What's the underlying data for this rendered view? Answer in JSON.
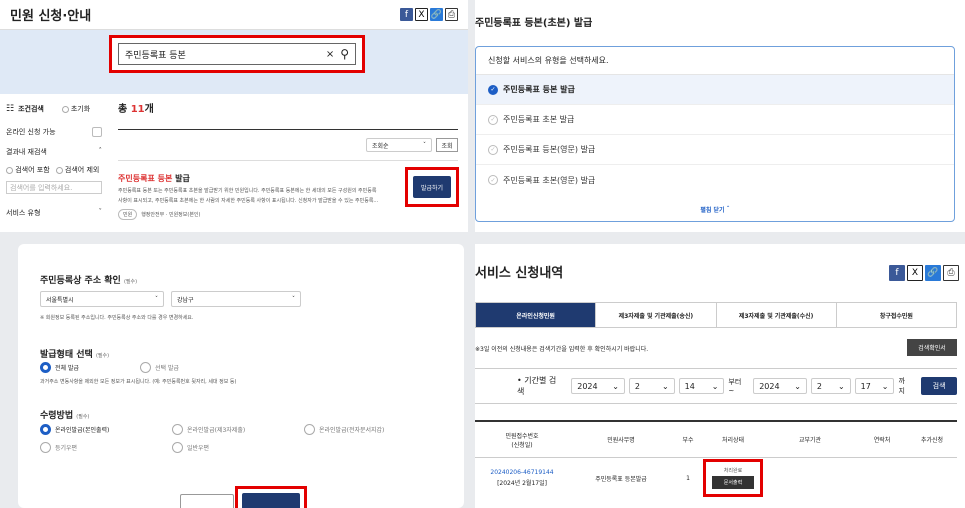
{
  "p1": {
    "title": "민원 신청·안내",
    "search_value": "주민등록표 등본",
    "filter": {
      "heading": "조건검색",
      "reset": "초기화",
      "online_label": "온라인 신청 가능",
      "result_search": "결과내 재검색",
      "opt_include": "검색어 포함",
      "opt_exclude": "검색어 제외",
      "placeholder": "검색어를 입력하세요.",
      "service_type": "서비스 유형"
    },
    "total_prefix": "총 ",
    "total_count": "11",
    "total_suffix": "개",
    "sort_value": "조회순",
    "sort_btn": "조회",
    "result": {
      "title_hl": "주민등록표 등본",
      "title_rest": " 발급",
      "desc1": "주민등록표 등본 또는 주민등록표 초본을 발급받기 위한 민원입니다. 주민등록표 등본에는 한 세대의 모든 구성원의 주민등록",
      "desc2": "사항이 표시되고, 주민등록표 초본에는 한 사람의 자세한 주민등록 사항이 표시됩니다. 신청자가 발급받을 수 있는 주민등록...",
      "tag": "민원",
      "org": "행정안전부 · 민원정보(본인)",
      "apply": "발급하기"
    }
  },
  "p2": {
    "title": "주민등록표 등본(초본) 발급",
    "prompt": "신청할 서비스의 유형을 선택하세요.",
    "options": [
      "주민등록표 등본 발급",
      "주민등록표 초본 발급",
      "주민등록표 등본(영문) 발급",
      "주민등록표 초본(영문) 발급"
    ],
    "collapse": "펼침 닫기"
  },
  "p3": {
    "address_title": "주민등록상 주소 확인",
    "required": "(필수)",
    "city": "서울특별시",
    "district": "강남구",
    "address_note": "※ 회원정보 등록된 주소입니다. 주민등록상 주소와 다를 경우 변경하세요.",
    "form_title": "발급형태 선택",
    "form_opts": [
      "전체 발급",
      "선택 발급"
    ],
    "form_note": "과거주소 변동사항을 제외한 모든 정보가 표시됩니다. (예: 주민등록번호 뒷자리, 세대 정보 등)",
    "recv_title": "수령방법",
    "recv_opts": [
      "온라인발급(본인출력)",
      "온라인발급(제3자제출)",
      "온라인발급(전자문서지갑)",
      "등기우편",
      "일반우편"
    ]
  },
  "p4": {
    "title": "서비스 신청내역",
    "tabs": [
      "온라인신청민원",
      "제3자제출 및 기관제출(송신)",
      "제3자제출 및 기관제출(수신)",
      "창구접수민원"
    ],
    "notice": "※3일 이전의 신청내용은 검색기간을 입력한 후 확인하시기 바랍니다.",
    "search_guide_btn": "검색확인서",
    "period_label": "• 기간별 검색",
    "from_year": "2024",
    "from_month": "2",
    "from_day": "14",
    "from_text": "부터 ~",
    "to_year": "2024",
    "to_month": "2",
    "to_day": "17",
    "to_text": "까지",
    "search_btn": "검색",
    "table_headers": [
      "민원접수번호\n(신청일)",
      "민원사무명",
      "부수",
      "처리상태",
      "교부기관",
      "연락처",
      "추가신청"
    ],
    "row": {
      "receipt_no": "20240206-46719144",
      "date": "[2024년 2월17일]",
      "name": "주민등록표 등본발급",
      "count": "1",
      "status": "처리완료",
      "print_btn": "문서출력"
    }
  }
}
